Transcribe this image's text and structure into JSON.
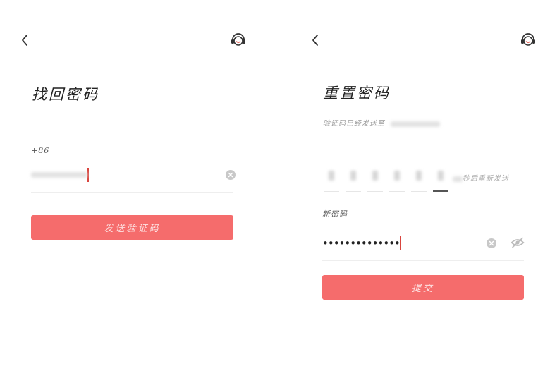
{
  "forgot": {
    "title": "找回密码",
    "country_code": "+86",
    "send_button_label": "发送验证码"
  },
  "reset": {
    "title": "重置密码",
    "code_sent_prefix": "验证码已经发送至",
    "resend_suffix": "秒后重新发送",
    "new_password_label": "新密码",
    "password_masked": "••••••••••••••",
    "submit_button_label": "提交"
  },
  "colors": {
    "primary": "#f56c6c",
    "caret": "#d9453e",
    "icon_accent": "#e55b4d"
  },
  "icons": {
    "back": "chevron-left-icon",
    "support": "customer-service-icon",
    "clear": "clear-icon",
    "visibility": "eye-off-icon"
  }
}
